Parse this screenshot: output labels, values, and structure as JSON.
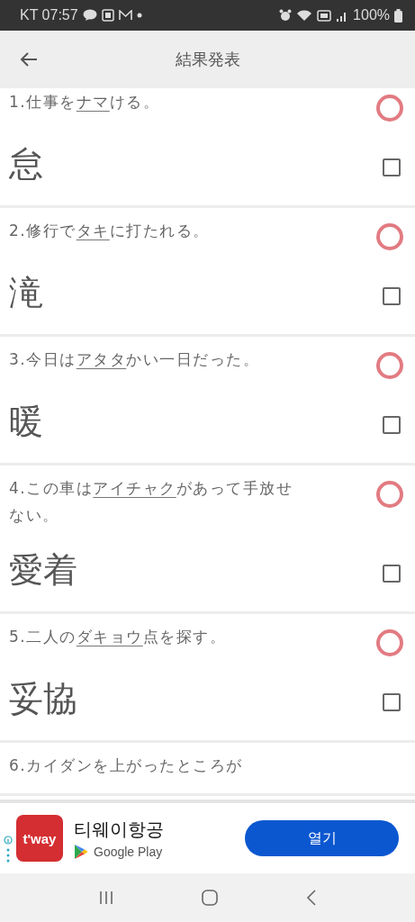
{
  "status_bar": {
    "carrier_time": "KT 07:57",
    "battery": "100%"
  },
  "header": {
    "title": "結果発表"
  },
  "questions": [
    {
      "number": "1.",
      "before": "仕事を",
      "underlined": "ナマ",
      "after": "ける。",
      "answer": "怠",
      "correct": true,
      "checked": false
    },
    {
      "number": "2.",
      "before": "修行で",
      "underlined": "タキ",
      "after": "に打たれる。",
      "answer": "滝",
      "correct": true,
      "checked": false
    },
    {
      "number": "3.",
      "before": "今日は",
      "underlined": "アタタ",
      "after": "かい一日だった。",
      "answer": "暖",
      "correct": true,
      "checked": false
    },
    {
      "number": "4.",
      "before": "この車は",
      "underlined": "アイチャク",
      "after": "があって手放せない。",
      "answer": "愛着",
      "correct": true,
      "checked": false
    },
    {
      "number": "5.",
      "before": "二人の",
      "underlined": "ダキョウ",
      "after": "点を探す。",
      "answer": "妥協",
      "correct": true,
      "checked": false
    },
    {
      "number": "6.",
      "after": "カイダンを上がったところが"
    }
  ],
  "ad": {
    "app_name": "티웨이항공",
    "logo_text": "t'way",
    "store": "Google Play",
    "button": "열기"
  }
}
